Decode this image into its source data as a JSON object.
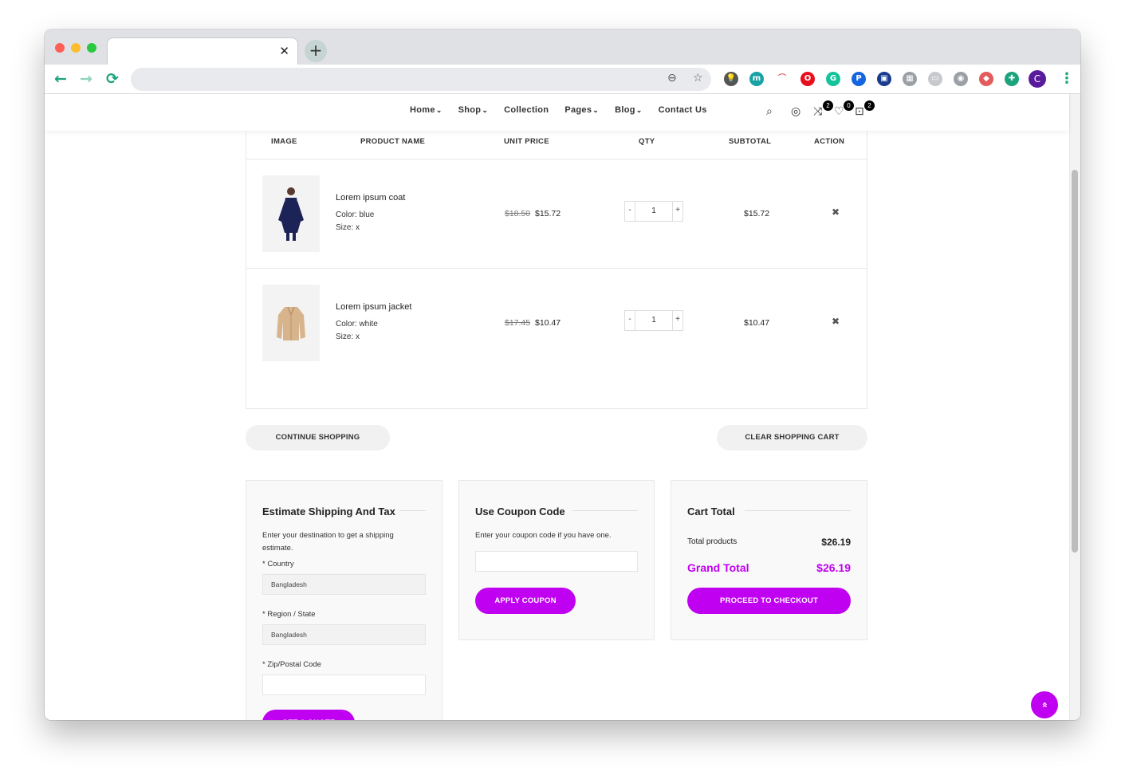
{
  "browser": {
    "tab_close": "✕",
    "new_tab": "+",
    "back": "←",
    "forward": "→",
    "reload": "⟳",
    "zoom": "⊖",
    "star": "☆",
    "profile_initial": "C",
    "menu": "⋮",
    "extensions": [
      {
        "name": "bulb-ext",
        "color": "#555555",
        "glyph": "💡"
      },
      {
        "name": "m-ext",
        "color": "#17a2a6",
        "glyph": "m"
      },
      {
        "name": "rainbow-ext",
        "color": "#ffffff",
        "glyph": "⌒"
      },
      {
        "name": "opera-ext",
        "color": "#e8101f",
        "glyph": "O"
      },
      {
        "name": "grammarly-ext",
        "color": "#15c39a",
        "glyph": "G"
      },
      {
        "name": "p-ext",
        "color": "#1565e0",
        "glyph": "P"
      },
      {
        "name": "book-ext",
        "color": "#1a3c8c",
        "glyph": "▣"
      },
      {
        "name": "person-ext",
        "color": "#9aa0a6",
        "glyph": "▦"
      },
      {
        "name": "window-ext",
        "color": "#c7c9cc",
        "glyph": "▭"
      },
      {
        "name": "chat-ext",
        "color": "#9aa0a6",
        "glyph": "◉"
      },
      {
        "name": "shapes-ext",
        "color": "#e45b5b",
        "glyph": "◆"
      },
      {
        "name": "puzzle-ext",
        "color": "#1aa37c",
        "glyph": "✚"
      }
    ]
  },
  "header": {
    "nav": [
      "Home",
      "Shop",
      "Collection",
      "Pages",
      "Blog",
      "Contact Us"
    ],
    "nav_has_dropdown": [
      true,
      true,
      false,
      true,
      true,
      false
    ],
    "compare_count": "2",
    "wishlist_count": "0",
    "cart_count": "2"
  },
  "cart": {
    "columns": [
      "IMAGE",
      "PRODUCT NAME",
      "UNIT PRICE",
      "QTY",
      "SUBTOTAL",
      "ACTION"
    ],
    "items": [
      {
        "name": "Lorem ipsum coat",
        "color": "Color: blue",
        "size": "Size: x",
        "old_price": "$18.50",
        "price": "$15.72",
        "qty": "1",
        "subtotal": "$15.72"
      },
      {
        "name": "Lorem ipsum jacket",
        "color": "Color: white",
        "size": "Size: x",
        "old_price": "$17.45",
        "price": "$10.47",
        "qty": "1",
        "subtotal": "$10.47"
      }
    ],
    "qty_minus": "-",
    "qty_plus": "+",
    "remove": "✖",
    "continue_label": "CONTINUE SHOPPING",
    "clear_label": "CLEAR SHOPPING CART"
  },
  "shipping": {
    "title": "Estimate Shipping And Tax",
    "intro": "Enter your destination to get a shipping estimate.",
    "country_label": "* Country",
    "country_value": "Bangladesh",
    "region_label": "* Region / State",
    "region_value": "Bangladesh",
    "zip_label": "* Zip/Postal Code",
    "zip_value": "",
    "button": "GET A QUOTE"
  },
  "coupon": {
    "title": "Use Coupon Code",
    "intro": "Enter your coupon code if you have one.",
    "value": "",
    "button": "APPLY COUPON"
  },
  "totals": {
    "title": "Cart Total",
    "products_label": "Total products",
    "products_value": "$26.19",
    "grand_label": "Grand Total",
    "grand_value": "$26.19",
    "button": "PROCEED TO CHECKOUT"
  },
  "scroll_top": "»",
  "colors": {
    "accent": "#c000f0",
    "browser_green": "#1aa37c"
  }
}
